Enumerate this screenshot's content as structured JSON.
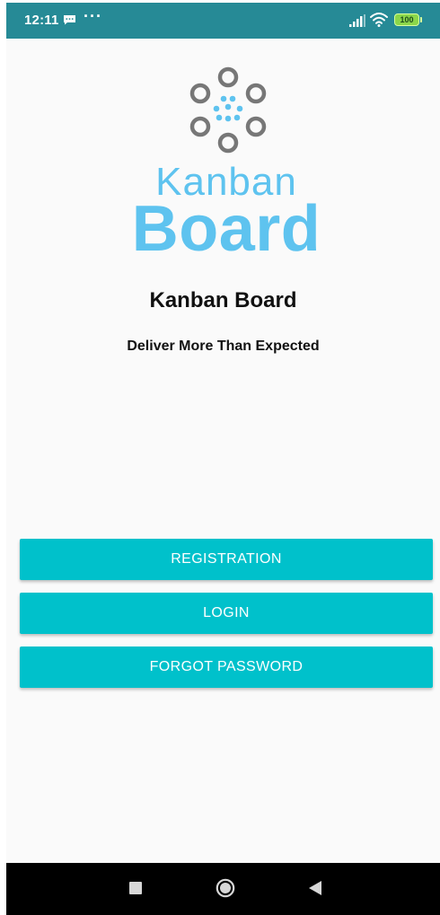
{
  "status_bar": {
    "time": "12:11",
    "more": "···",
    "battery_level": "100",
    "background_color": "#268a96",
    "icons": [
      "message-icon",
      "signal-icon",
      "wifi-icon",
      "battery-icon"
    ]
  },
  "logo": {
    "word_top": "Kanban",
    "word_bottom": "Board",
    "brand_color": "#5ec3ef",
    "ring_color": "#777777",
    "icon": "kanban-logo-icon"
  },
  "header": {
    "title": "Kanban Board",
    "tagline": "Deliver More Than Expected"
  },
  "actions": {
    "registration_label": "REGISTRATION",
    "login_label": "LOGIN",
    "forgot_password_label": "FORGOT PASSWORD",
    "button_color": "#00c1cb"
  },
  "nav_bar": {
    "icons": [
      "recents-icon",
      "home-icon",
      "back-icon"
    ]
  }
}
